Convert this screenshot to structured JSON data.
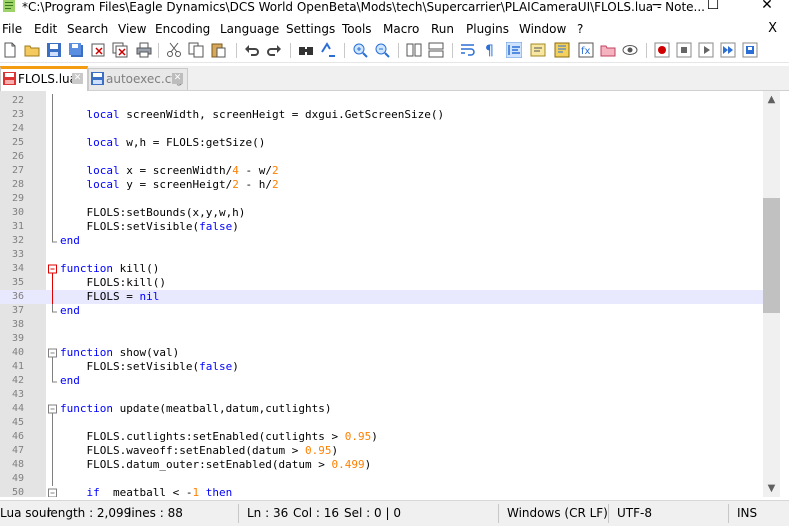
{
  "window": {
    "title": "*C:\\Program Files\\Eagle Dynamics\\DCS World OpenBeta\\Mods\\tech\\Supercarrier\\PLAICameraUI\\FLOLS.lua - Note...",
    "minimize": "−",
    "maximize": "☐",
    "close": "✕"
  },
  "menu": {
    "items": [
      "File",
      "Edit",
      "Search",
      "View",
      "Encoding",
      "Language",
      "Settings",
      "Tools",
      "Macro",
      "Run",
      "Plugins",
      "Window",
      "?"
    ],
    "close_glyph": "X"
  },
  "toolbar": {
    "icons": [
      "new-file-icon",
      "open-file-icon",
      "save-icon",
      "save-all-icon",
      "close-icon",
      "close-all-icon",
      "print-icon",
      "cut-icon",
      "copy-icon",
      "paste-icon",
      "undo-icon",
      "redo-icon",
      "find-icon",
      "replace-icon",
      "zoom-in-icon",
      "zoom-out-icon",
      "sync-vertical-icon",
      "sync-horizontal-icon",
      "word-wrap-icon",
      "show-all-chars-icon",
      "indent-guide-icon",
      "language-udl-icon",
      "doc-map-icon",
      "function-list-icon",
      "folder-workspace-icon",
      "monitoring-icon",
      "record-macro-icon",
      "stop-macro-icon",
      "play-macro-icon",
      "run-macro-multiple-icon",
      "save-macro-icon"
    ]
  },
  "tabs": [
    {
      "label": "FLOLS.lua",
      "active": true,
      "icon": "modified-file-icon",
      "accent": "#f39c12"
    },
    {
      "label": "autoexec.cfg",
      "active": false,
      "icon": "saved-file-icon"
    }
  ],
  "editor": {
    "current_line": 36,
    "lines": [
      {
        "n": "22",
        "fold": "line",
        "text": ""
      },
      {
        "n": "23",
        "fold": "line",
        "text": "    local screenWidth, screenHeigt = dxgui.GetScreenSize()"
      },
      {
        "n": "24",
        "fold": "line",
        "text": ""
      },
      {
        "n": "25",
        "fold": "line",
        "text": "    local w,h = FLOLS:getSize()"
      },
      {
        "n": "26",
        "fold": "line",
        "text": ""
      },
      {
        "n": "27",
        "fold": "line",
        "text": "    local x = screenWidth/4 - w/2"
      },
      {
        "n": "28",
        "fold": "line",
        "text": "    local y = screenHeigt/2 - h/2"
      },
      {
        "n": "29",
        "fold": "line",
        "text": ""
      },
      {
        "n": "30",
        "fold": "line",
        "text": "    FLOLS:setBounds(x,y,w,h)"
      },
      {
        "n": "31",
        "fold": "line",
        "text": "    FLOLS:setVisible(false)"
      },
      {
        "n": "32",
        "fold": "end",
        "text": "end"
      },
      {
        "n": "33",
        "fold": "none",
        "text": ""
      },
      {
        "n": "34",
        "fold": "box-red",
        "text": "function kill()"
      },
      {
        "n": "35",
        "fold": "line-red",
        "text": "    FLOLS:kill()"
      },
      {
        "n": "36",
        "fold": "line-red",
        "text": "    FLOLS = nil"
      },
      {
        "n": "37",
        "fold": "end",
        "text": "end"
      },
      {
        "n": "38",
        "fold": "none",
        "text": ""
      },
      {
        "n": "39",
        "fold": "none",
        "text": ""
      },
      {
        "n": "40",
        "fold": "box",
        "text": "function show(val)"
      },
      {
        "n": "41",
        "fold": "line",
        "text": "    FLOLS:setVisible(false)"
      },
      {
        "n": "42",
        "fold": "end",
        "text": "end"
      },
      {
        "n": "43",
        "fold": "none",
        "text": ""
      },
      {
        "n": "44",
        "fold": "box",
        "text": "function update(meatball,datum,cutlights)"
      },
      {
        "n": "45",
        "fold": "line",
        "text": ""
      },
      {
        "n": "46",
        "fold": "line",
        "text": "    FLOLS.cutlights:setEnabled(cutlights > 0.95)"
      },
      {
        "n": "47",
        "fold": "line",
        "text": "    FLOLS.waveoff:setEnabled(datum > 0.95)"
      },
      {
        "n": "48",
        "fold": "line",
        "text": "    FLOLS.datum_outer:setEnabled(datum > 0.499)"
      },
      {
        "n": "49",
        "fold": "line",
        "text": ""
      },
      {
        "n": "50",
        "fold": "box",
        "text": "    if  meatball < -1 then"
      }
    ]
  },
  "status": {
    "lang": "Lua sour",
    "length": "length : 2,099",
    "lines": "lines : 88",
    "ln": "Ln : 36",
    "col": "Col : 16",
    "sel": "Sel : 0 | 0",
    "eol": "Windows (CR LF)",
    "encoding": "UTF-8",
    "mode": "INS"
  }
}
